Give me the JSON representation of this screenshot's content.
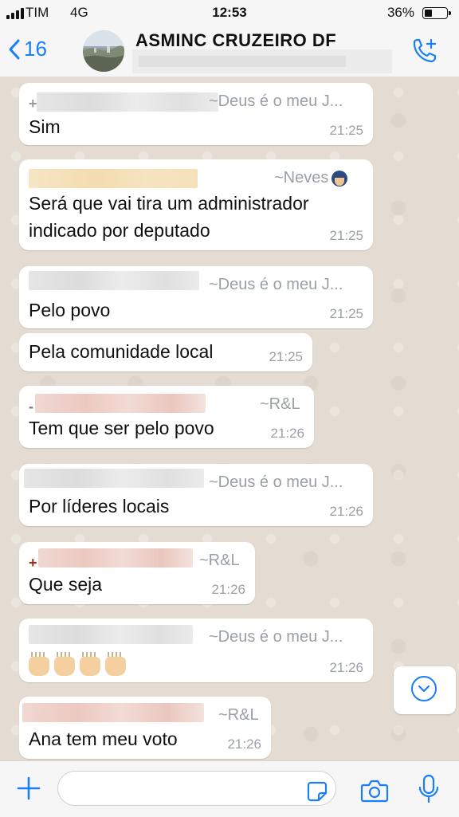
{
  "status_bar": {
    "carrier": "TIM",
    "network": "4G",
    "time": "12:53",
    "battery_percent": "36%",
    "battery_level": 0.36,
    "icons": [
      "signal-icon",
      "battery-icon"
    ]
  },
  "header": {
    "back_count": "16",
    "chat_title": "ASMINC CRUZEIRO DF",
    "icons": [
      "back-chevron-icon",
      "add-call-icon"
    ],
    "accent_color": "#1a7ef6"
  },
  "messages": [
    {
      "sender": "~Deus é o meu J...",
      "text": [
        "Sim"
      ],
      "time": "21:25"
    },
    {
      "sender": "~Neves",
      "text": [
        "Será que vai tira um administrador",
        "indicado por deputado"
      ],
      "time": "21:25"
    },
    {
      "sender": "~Deus é o meu J...",
      "text": [
        "Pelo povo"
      ],
      "time": "21:25"
    },
    {
      "sender": "",
      "text": [
        "Pela comunidade local"
      ],
      "time": "21:25"
    },
    {
      "sender": "~R&L",
      "text": [
        "Tem que ser pelo povo"
      ],
      "time": "21:26"
    },
    {
      "sender": "~Deus é o meu J...",
      "text": [
        "Por  líderes locais"
      ],
      "time": "21:26"
    },
    {
      "sender": "~R&L",
      "text": [
        "Que seja"
      ],
      "time": "21:26"
    },
    {
      "sender": "~Deus é o meu J...",
      "text": [],
      "emoji": "raised-hands-icon",
      "time": "21:26"
    },
    {
      "sender": "~R&L",
      "text": [
        "Ana tem meu voto"
      ],
      "time": "21:26"
    }
  ],
  "input_bar": {
    "placeholder": "",
    "icons": [
      "plus-icon",
      "sticker-icon",
      "camera-icon",
      "mic-icon"
    ]
  },
  "scroll_button": {
    "icon": "chevron-down-icon"
  }
}
